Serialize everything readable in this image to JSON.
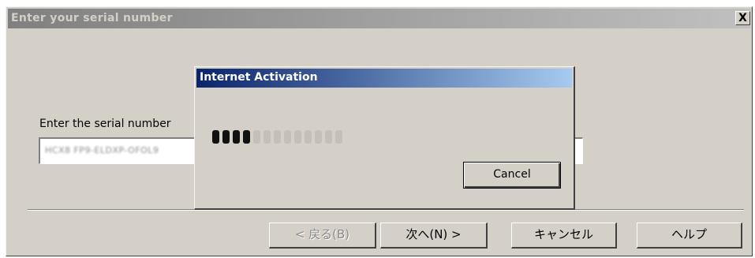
{
  "wizard": {
    "title": "Enter your serial number",
    "close_label": "X",
    "serial_label": "Enter the serial number",
    "serial_value": "HCX8 FP9-ELDXP-OFOL9",
    "buttons": {
      "back": "< 戻る(B)",
      "next": "次へ(N) >",
      "cancel": "キャンセル",
      "help": "ヘルプ"
    }
  },
  "activation": {
    "title": "Internet Activation",
    "cancel_label": "Cancel",
    "progress": {
      "total_segments": 13,
      "filled_segments": 4
    }
  },
  "colors": {
    "dialog_face": "#d4d0c8",
    "active_title_start": "#0a246a",
    "active_title_end": "#a6caf0",
    "inactive_title_start": "#808080",
    "inactive_title_end": "#c0c0c0"
  }
}
